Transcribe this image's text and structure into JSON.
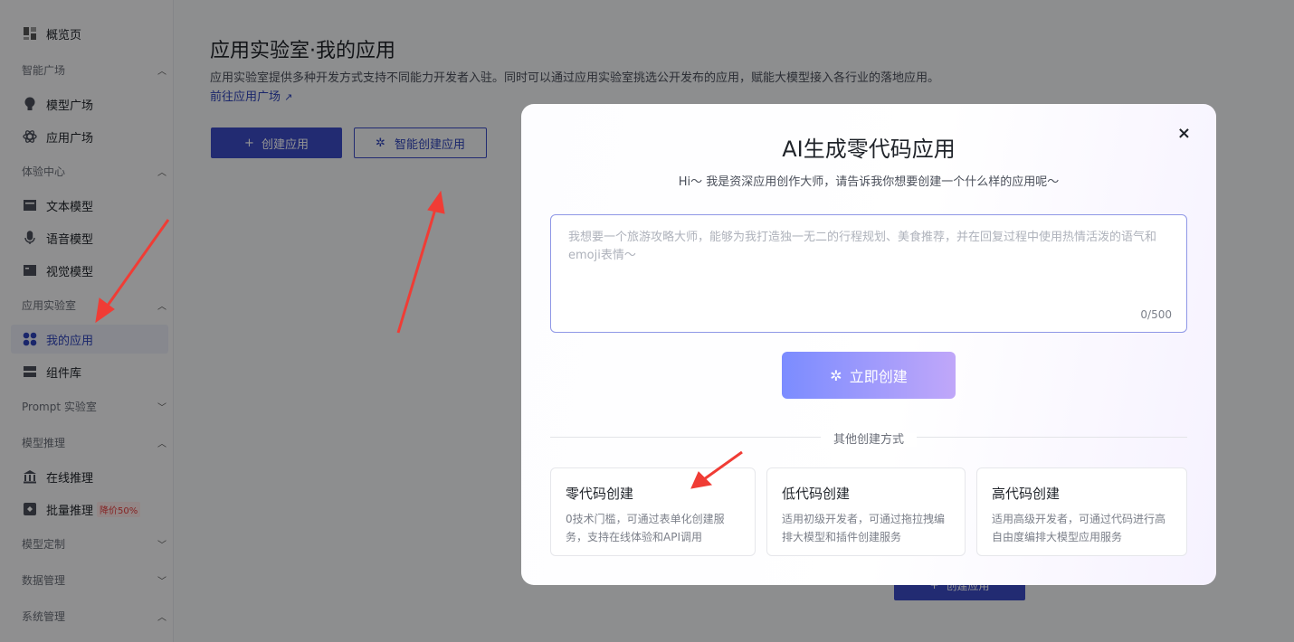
{
  "sidebar": {
    "overview": "概览页",
    "groups": {
      "smart_square": "智能广场",
      "experience": "体验中心",
      "app_lab": "应用实验室",
      "prompt_lab": "Prompt 实验室",
      "model_inference": "模型推理",
      "model_custom": "模型定制",
      "data_mgmt": "数据管理",
      "system_mgmt": "系统管理"
    },
    "items": {
      "model_square": "模型广场",
      "app_square": "应用广场",
      "text_model": "文本模型",
      "voice_model": "语音模型",
      "vision_model": "视觉模型",
      "my_apps": "我的应用",
      "component_lib": "组件库",
      "online_inference": "在线推理",
      "batch_inference": "批量推理",
      "batch_badge": "降价50%"
    }
  },
  "main": {
    "title": "应用实验室·我的应用",
    "description": "应用实验室提供多种开发方式支持不同能力开发者入驻。同时可以通过应用实验室挑选公开发布的应用，赋能大模型接入各行业的落地应用。",
    "link": "前往应用广场",
    "create_btn": "创建应用",
    "smart_create_btn": "智能创建应用",
    "create_btn_bottom": "创建应用"
  },
  "modal": {
    "title": "AI生成零代码应用",
    "subtitle": "Hi～ 我是资深应用创作大师，请告诉我你想要创建一个什么样的应用呢～",
    "placeholder": "我想要一个旅游攻略大师，能够为我打造独一无二的行程规划、美食推荐，并在回复过程中使用热情活泼的语气和emoji表情～",
    "counter": "0/500",
    "go_btn": "立即创建",
    "divider_label": "其他创建方式",
    "cards": [
      {
        "title": "零代码创建",
        "desc": "0技术门槛，可通过表单化创建服务，支持在线体验和API调用"
      },
      {
        "title": "低代码创建",
        "desc": "适用初级开发者，可通过拖拉拽编排大模型和插件创建服务"
      },
      {
        "title": "高代码创建",
        "desc": "适用高级开发者，可通过代码进行高自由度编排大模型应用服务"
      }
    ],
    "close_glyph": "×"
  },
  "colors": {
    "accent": "#3c4bc4",
    "annotation_arrow": "#f03c35"
  }
}
